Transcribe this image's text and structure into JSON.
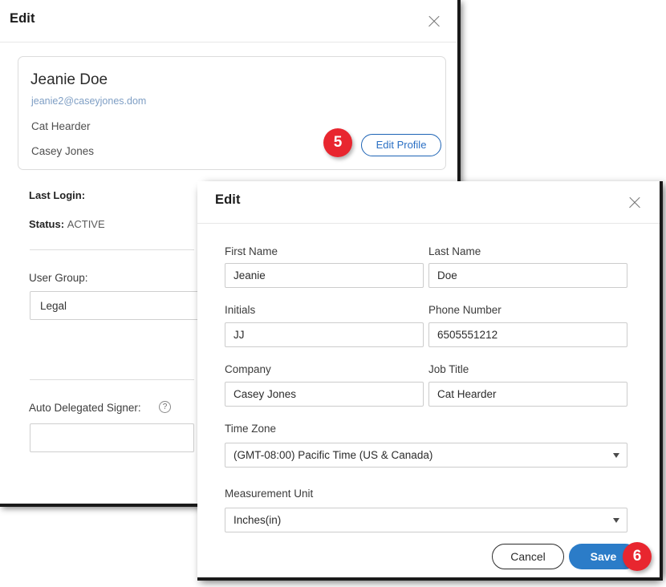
{
  "back_panel": {
    "title": "Edit",
    "close_icon": "close-icon",
    "profile": {
      "name": "Jeanie Doe",
      "email": "jeanie2@caseyjones.dom",
      "job_title": "Cat Hearder",
      "company": "Casey Jones",
      "edit_profile_label": "Edit Profile"
    },
    "details": {
      "last_login_label": "Last Login:",
      "last_login_value": "",
      "status_label": "Status:",
      "status_value": "ACTIVE",
      "user_group_label": "User Group:",
      "user_group_value": "Legal",
      "auto_delegated_label": "Auto Delegated Signer:",
      "auto_delegated_value": "",
      "help_icon_glyph": "?"
    }
  },
  "front_dialog": {
    "title": "Edit",
    "close_icon": "close-icon",
    "fields": {
      "first_name_label": "First Name",
      "first_name_value": "Jeanie",
      "last_name_label": "Last Name",
      "last_name_value": "Doe",
      "initials_label": "Initials",
      "initials_value": "JJ",
      "phone_label": "Phone Number",
      "phone_value": "6505551212",
      "company_label": "Company",
      "company_value": "Casey Jones",
      "job_title_label": "Job Title",
      "job_title_value": "Cat Hearder",
      "time_zone_label": "Time Zone",
      "time_zone_value": "(GMT-08:00) Pacific Time (US & Canada)",
      "measurement_unit_label": "Measurement Unit",
      "measurement_unit_value": "Inches(in)"
    },
    "footer": {
      "cancel_label": "Cancel",
      "save_label": "Save"
    }
  },
  "callouts": [
    {
      "number": "5"
    },
    {
      "number": "6"
    }
  ],
  "colors": {
    "badge_red": "#e8262f",
    "save_blue": "#2b7cc8",
    "link_blue": "#2a6fc4",
    "email_blue": "#7e9ec4"
  }
}
